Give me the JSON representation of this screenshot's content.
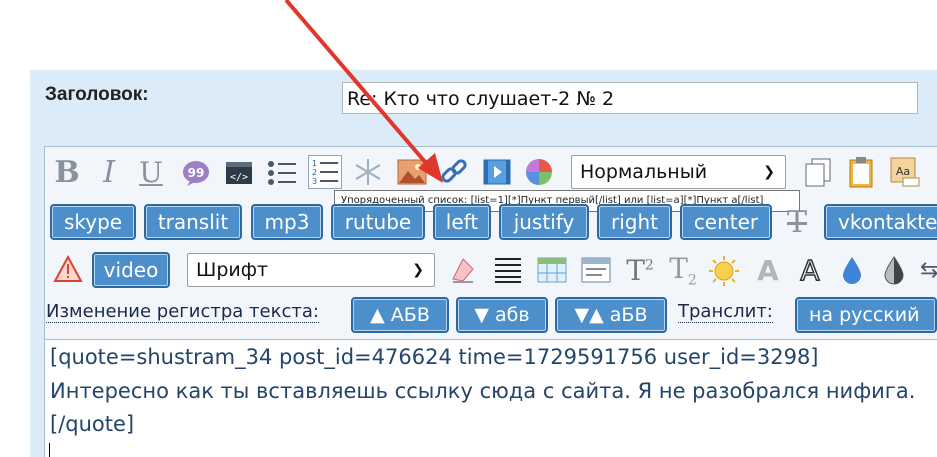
{
  "form": {
    "title_label": "Заголовок:",
    "title_value": "Re: Кто что слушает-2 № 2"
  },
  "toolbar": {
    "row1_icons": [
      "bold-icon",
      "italic-icon",
      "underline-icon",
      "quote-icon",
      "code-icon",
      "bulleted-list-icon",
      "ordered-list-icon",
      "snowflake-icon",
      "image-icon",
      "link-icon",
      "video-icon",
      "color-icon"
    ],
    "format_select": "Нормальный",
    "row1_right_icons": [
      "copy-icon",
      "paste-icon",
      "highlight-aa-icon"
    ],
    "tooltip": "Упорядоченный список: [list=1][*]Пункт первый[/list] или [list=a][*]Пункт a[/list]",
    "tags": [
      "skype",
      "translit",
      "mp3",
      "rutube",
      "left",
      "justify",
      "right",
      "center",
      "vkontakte"
    ],
    "strike_icon": "T-strike-icon",
    "video_label": "video",
    "font_select": "Шрифт",
    "row3_icons": [
      "warning-icon",
      "eraser-icon",
      "align-justify-icon",
      "table-icon",
      "spoiler-icon",
      "superscript-icon",
      "subscript-icon",
      "sun-icon",
      "font-a-icon",
      "font-a-outline-icon",
      "drop-icon",
      "contrast-icon",
      "arrows-icon"
    ]
  },
  "case_row": {
    "label": "Изменение регистра текста:",
    "upper": "▲ АБВ",
    "lower": "▼ абв",
    "invert": "▼▲ аБВ",
    "translit_label": "Транслит:",
    "to_russian": "на русский"
  },
  "message": {
    "line1": "[quote=shustram_34 post_id=476624 time=1729591756 user_id=3298]",
    "line2": "Интересно как ты вставляешь ссылку сюда с сайта. Я не разобрался нифига.",
    "line3": "[/quote]"
  },
  "colors": {
    "panel": "#dcebf8",
    "button": "#4d8fcb",
    "arrow": "#e0362c"
  }
}
